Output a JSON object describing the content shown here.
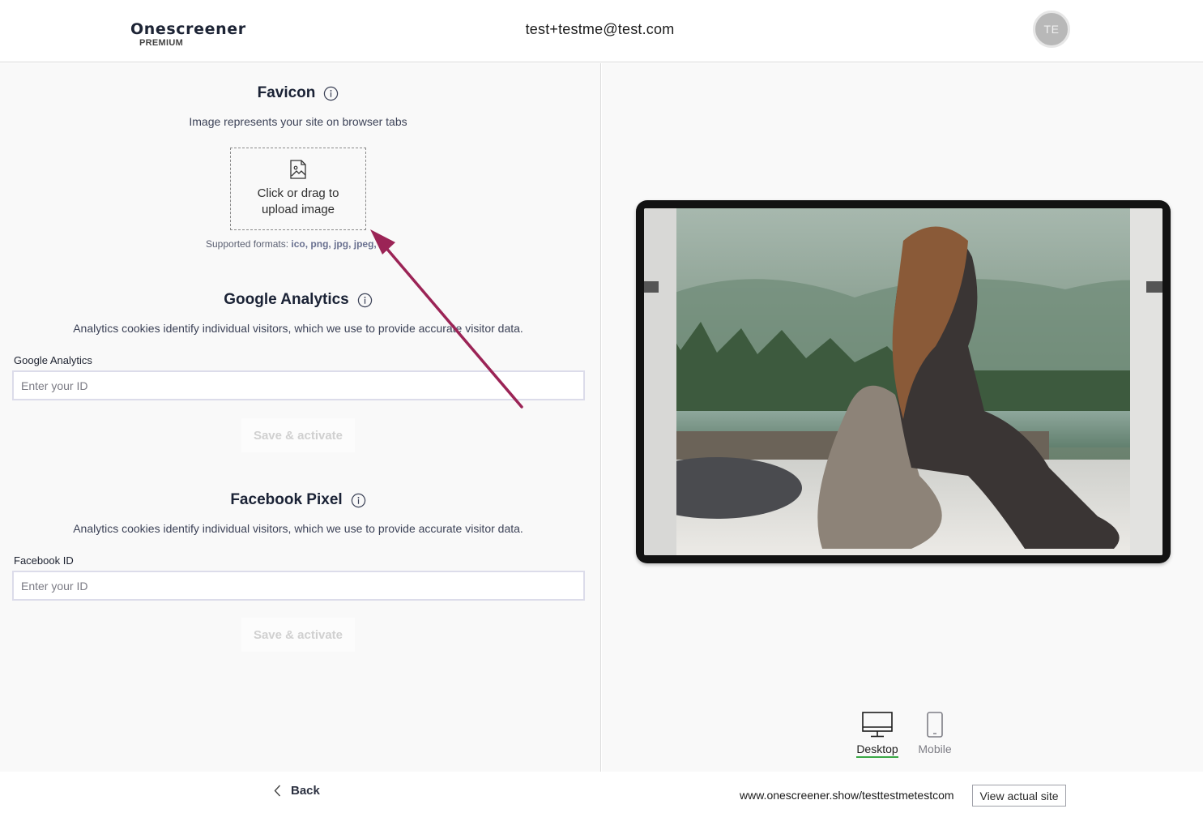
{
  "header": {
    "brand": "Onescreener",
    "tier": "PREMIUM",
    "email": "test+testme@test.com",
    "avatar_initials": "TE"
  },
  "favicon": {
    "title": "Favicon",
    "description": "Image represents your site on browser tabs",
    "upload_line1": "Click or drag to",
    "upload_line2": "upload image",
    "formats_label": "Supported formats:",
    "formats_list": "ico, png, jpg, jpeg, gif"
  },
  "google_analytics": {
    "title": "Google Analytics",
    "description": "Analytics cookies identify individual visitors, which we use to provide accurate visitor data.",
    "field_label": "Google Analytics",
    "placeholder": "Enter your ID",
    "save_label": "Save & activate"
  },
  "facebook_pixel": {
    "title": "Facebook Pixel",
    "description": "Analytics cookies identify individual visitors, which we use to provide accurate visitor data.",
    "field_label": "Facebook ID",
    "placeholder": "Enter your ID",
    "save_label": "Save & activate"
  },
  "preview": {
    "desktop_label": "Desktop",
    "mobile_label": "Mobile",
    "selected": "Desktop"
  },
  "footer": {
    "back_label": "Back",
    "site_url": "www.onescreener.show/testtestmetestcom",
    "view_site_label": "View actual site"
  },
  "colors": {
    "active_underline": "#39a845",
    "annotation_arrow": "#9b2456"
  }
}
